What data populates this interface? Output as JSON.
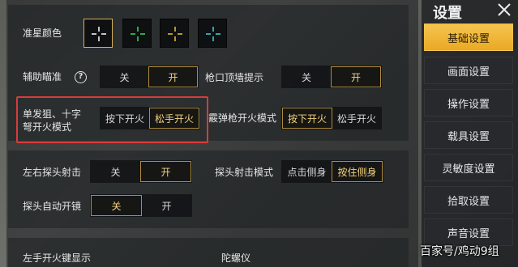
{
  "crosshair_color": {
    "label": "准星颜色",
    "options": [
      {
        "name": "white",
        "color": "#ffffff",
        "selected": true
      },
      {
        "name": "green",
        "color": "#3ddc5a",
        "selected": false
      },
      {
        "name": "yellow",
        "color": "#e8c53a",
        "selected": false
      },
      {
        "name": "cyan",
        "color": "#3fd6e0",
        "selected": false
      }
    ]
  },
  "aim_assist": {
    "label": "辅助瞄准",
    "help_icon": "?",
    "off": "关",
    "on": "开",
    "value": "开"
  },
  "muzzle_hint": {
    "label": "枪口顶墙提示",
    "off": "关",
    "on": "开",
    "value": "开"
  },
  "single_fire": {
    "label_line1": "单发狙、十字",
    "label_line2": "弩开火模式",
    "opt1": "按下开火",
    "opt2": "松手开火",
    "value": "松手开火"
  },
  "shotgun_fire": {
    "label": "霰弹枪开火模式",
    "opt1": "按下开火",
    "opt2": "松手开火",
    "value": "按下开火"
  },
  "peek_fire": {
    "label": "左右探头射击",
    "off": "关",
    "on": "开",
    "value": "开"
  },
  "peek_mode": {
    "label": "探头射击模式",
    "opt1": "点击侧身",
    "opt2": "按住侧身",
    "value": "按住侧身"
  },
  "auto_scope": {
    "label": "探头自动开镜",
    "off": "关",
    "on": "开",
    "value": "关"
  },
  "left_fire": {
    "label": "左手开火键显示"
  },
  "gyroscope": {
    "label": "陀螺仪"
  },
  "sidebar": {
    "title": "设置",
    "items": [
      "基础设置",
      "画面设置",
      "操作设置",
      "载具设置",
      "灵敏度设置",
      "拾取设置",
      "声音设置"
    ],
    "active": "基础设置"
  },
  "watermark": "百家号/鸡动9组"
}
